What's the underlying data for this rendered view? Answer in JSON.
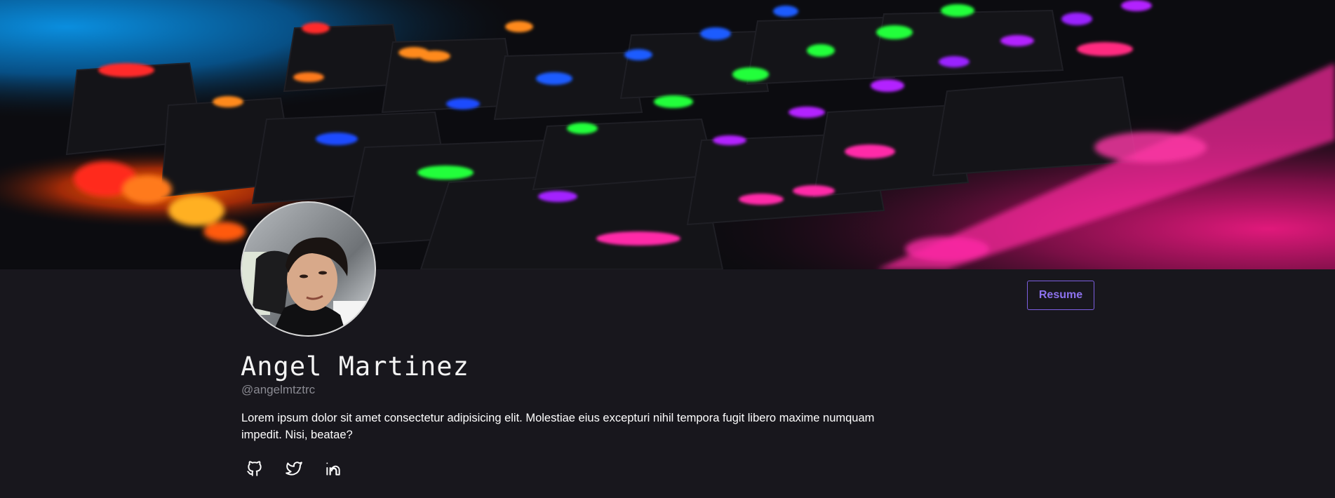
{
  "profile": {
    "name": "Angel Martinez",
    "handle": "@angelmtztrc",
    "bio": "Lorem ipsum dolor sit amet consectetur adipisicing elit. Molestiae eius excepturi nihil tempora fugit libero maxime numquam impedit. Nisi, beatae?",
    "resume_label": "Resume"
  },
  "banner": {
    "description_icon": "keyboard-rgb-banner"
  },
  "socials": [
    {
      "icon": "github-icon"
    },
    {
      "icon": "twitter-icon"
    },
    {
      "icon": "linkedin-icon"
    }
  ],
  "colors": {
    "background": "#18171d",
    "accent": "#8d72ee",
    "handle_text": "#8a8a92"
  }
}
